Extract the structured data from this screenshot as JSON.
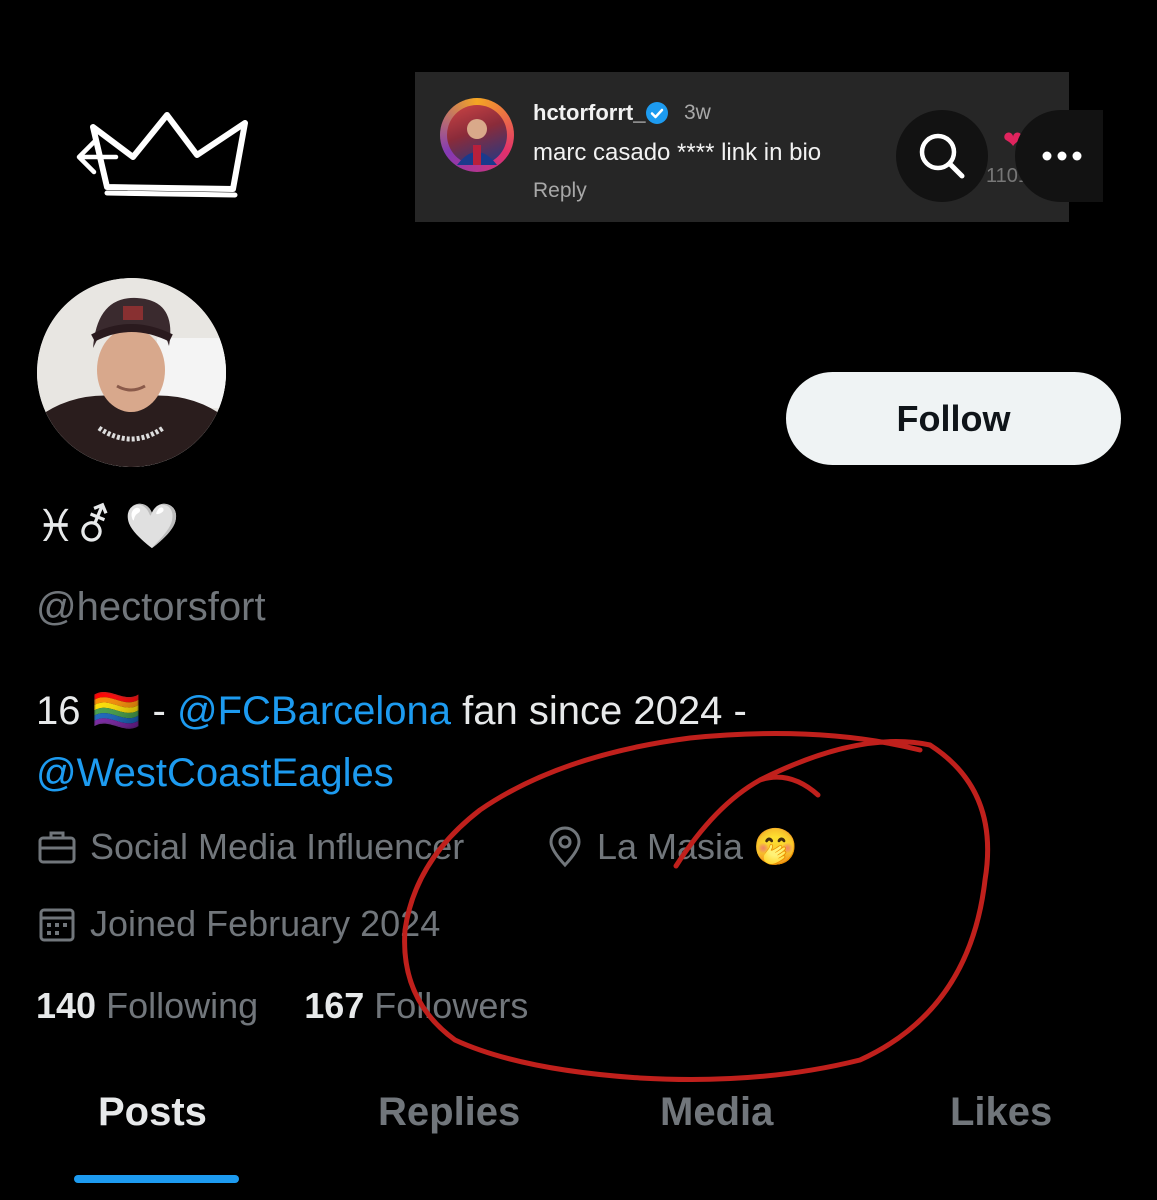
{
  "header": {
    "back_icon": "arrow-left-icon",
    "banner_icon": "crown-icon"
  },
  "comment_overlay": {
    "username": "hctorforrt_",
    "time": "3w",
    "text": "marc casado **** link in bio",
    "reply_label": "Reply",
    "likes": "11013"
  },
  "profile": {
    "display_name": "♓︎⚦ 🤍",
    "handle": "@hectorsfort",
    "follow_label": "Follow",
    "bio": {
      "part1": "16 🏳️‍🌈 - ",
      "mention1": "@FCBarcelona",
      "part2": " fan since 2024 -",
      "mention2": "@WestCoastEagles"
    },
    "profession": "Social Media Influencer",
    "location": "La Masia 🤭",
    "joined": "Joined February 2024",
    "following_count": "140",
    "following_label": "Following",
    "followers_count": "167",
    "followers_label": "Followers"
  },
  "tabs": [
    {
      "label": "Posts",
      "active": true
    },
    {
      "label": "Replies",
      "active": false
    },
    {
      "label": "Media",
      "active": false
    },
    {
      "label": "Likes",
      "active": false
    }
  ],
  "colors": {
    "accent": "#1d9bf0",
    "annotation": "#c0201c",
    "background": "#000000"
  }
}
